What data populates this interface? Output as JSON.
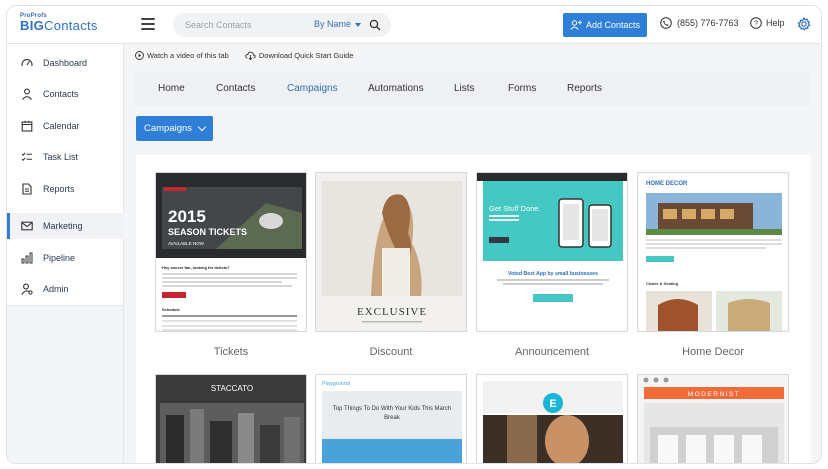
{
  "header": {
    "logo_small": "ProProfs",
    "logo_big_bold": "BIG",
    "logo_big_thin": "Contacts",
    "search_placeholder": "Search Contacts",
    "search_mode": "By Name",
    "add_contacts": "Add Contacts",
    "phone": "(855) 776-7763",
    "help": "Help"
  },
  "sidebar": {
    "items": [
      {
        "label": "Dashboard",
        "icon": "gauge-icon"
      },
      {
        "label": "Contacts",
        "icon": "person-icon"
      },
      {
        "label": "Calendar",
        "icon": "calendar-icon"
      },
      {
        "label": "Task List",
        "icon": "checklist-icon"
      },
      {
        "label": "Reports",
        "icon": "document-icon"
      },
      {
        "label": "Marketing",
        "icon": "envelope-icon",
        "active": true
      },
      {
        "label": "Pipeline",
        "icon": "bar-chart-icon"
      },
      {
        "label": "Admin",
        "icon": "user-gear-icon"
      }
    ]
  },
  "toplinks": {
    "video": "Watch a video of this tab",
    "guide": "Download Quick Start Guide"
  },
  "tabs": [
    "Home",
    "Contacts",
    "Campaigns",
    "Automations",
    "Lists",
    "Forms",
    "Reports"
  ],
  "active_tab": "Campaigns",
  "campaigns_button": "Campaigns",
  "templates": [
    {
      "name": "Tickets",
      "headline": "2015",
      "sub": "SEASON TICKETS",
      "tag": "AVAILABLE NOW",
      "body_title": "Hey soccer fan, looking for tickets?",
      "section": "Schedule"
    },
    {
      "name": "Discount",
      "headline": "EXCLUSIVE"
    },
    {
      "name": "Announcement",
      "headline": "Get Stuff Done.",
      "body_title": "Voted Best App by small businesses"
    },
    {
      "name": "Home Decor",
      "headline": "HOME DECOR",
      "section": "Chairs & Seating"
    },
    {
      "name": "",
      "headline": "STACCATO"
    },
    {
      "name": "",
      "headline": "Playground",
      "body_title": "Top Things To Do With Your Kids This March Break"
    },
    {
      "name": "",
      "headline": "E"
    },
    {
      "name": "",
      "headline": "MODERNIST"
    }
  ],
  "colors": {
    "accent": "#2f7ed8",
    "active_tab": "#2f6fb7",
    "sidebar_text": "#2b3a55"
  }
}
